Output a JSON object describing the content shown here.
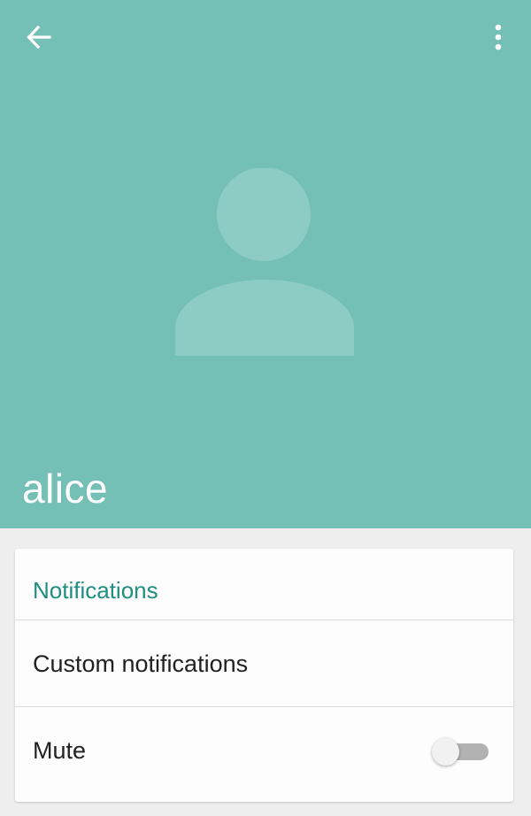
{
  "app_bar": {
    "back_icon": "arrow-left-icon",
    "menu_icon": "more-vert-icon",
    "background_color": "#74bfb6"
  },
  "contact": {
    "name": "alice",
    "avatar_icon": "default-person-avatar-icon"
  },
  "settings": {
    "section_title": "Notifications",
    "accent_color": "#1e8e80",
    "custom_notifications_label": "Custom notifications",
    "mute_label": "Mute",
    "mute_enabled": false
  }
}
